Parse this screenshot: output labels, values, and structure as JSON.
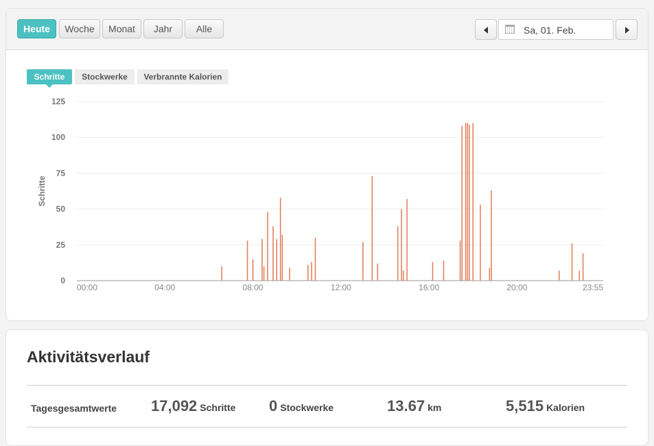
{
  "toolbar": {
    "ranges": [
      "Heute",
      "Woche",
      "Monat",
      "Jahr",
      "Alle"
    ],
    "active_range": "Heute",
    "date": "Sa, 01. Feb."
  },
  "metric_tabs": [
    "Schritte",
    "Stockwerke",
    "Verbrannte Kalorien"
  ],
  "active_metric": "Schritte",
  "chart_data": {
    "type": "bar",
    "ylabel": "Schritte",
    "xlabel": "",
    "ylim": [
      0,
      125
    ],
    "y_ticks": [
      0,
      25,
      50,
      75,
      100,
      125
    ],
    "xlim_minutes": [
      0,
      1435
    ],
    "x_tick_labels": [
      "00:00",
      "04:00",
      "08:00",
      "12:00",
      "16:00",
      "20:00",
      "23:55"
    ],
    "x_tick_minutes": [
      0,
      240,
      480,
      720,
      960,
      1200,
      1435
    ],
    "grid": true,
    "color": "#e07b54",
    "series": [
      {
        "x": [
          "06:35",
          "07:45",
          "08:00",
          "08:25",
          "08:30",
          "08:40",
          "08:55",
          "09:05",
          "09:15",
          "09:20",
          "09:40",
          "10:30",
          "10:40",
          "10:50",
          "13:00",
          "13:25",
          "13:40",
          "14:35",
          "14:45",
          "14:50",
          "15:00",
          "16:10",
          "16:40",
          "17:25",
          "17:30",
          "17:40",
          "17:45",
          "17:50",
          "18:00",
          "18:20",
          "18:45",
          "18:50",
          "21:55",
          "22:30",
          "22:50",
          "23:00"
        ],
        "values": [
          10,
          28,
          15,
          29,
          10,
          48,
          38,
          29,
          58,
          32,
          9,
          11,
          13,
          30,
          27,
          73,
          12,
          38,
          50,
          7,
          57,
          13,
          14,
          28,
          108,
          110,
          110,
          109,
          110,
          53,
          9,
          63,
          7,
          26,
          7,
          19
        ]
      }
    ]
  },
  "activity": {
    "title": "Aktivitätsverlauf",
    "totals_label": "Tagesgesamtwerte",
    "stats": [
      {
        "value": "17,092",
        "unit": "Schritte"
      },
      {
        "value": "0",
        "unit": "Stockwerke"
      },
      {
        "value": "13.67",
        "unit": "km"
      },
      {
        "value": "5,515",
        "unit": "Kalorien"
      }
    ]
  }
}
